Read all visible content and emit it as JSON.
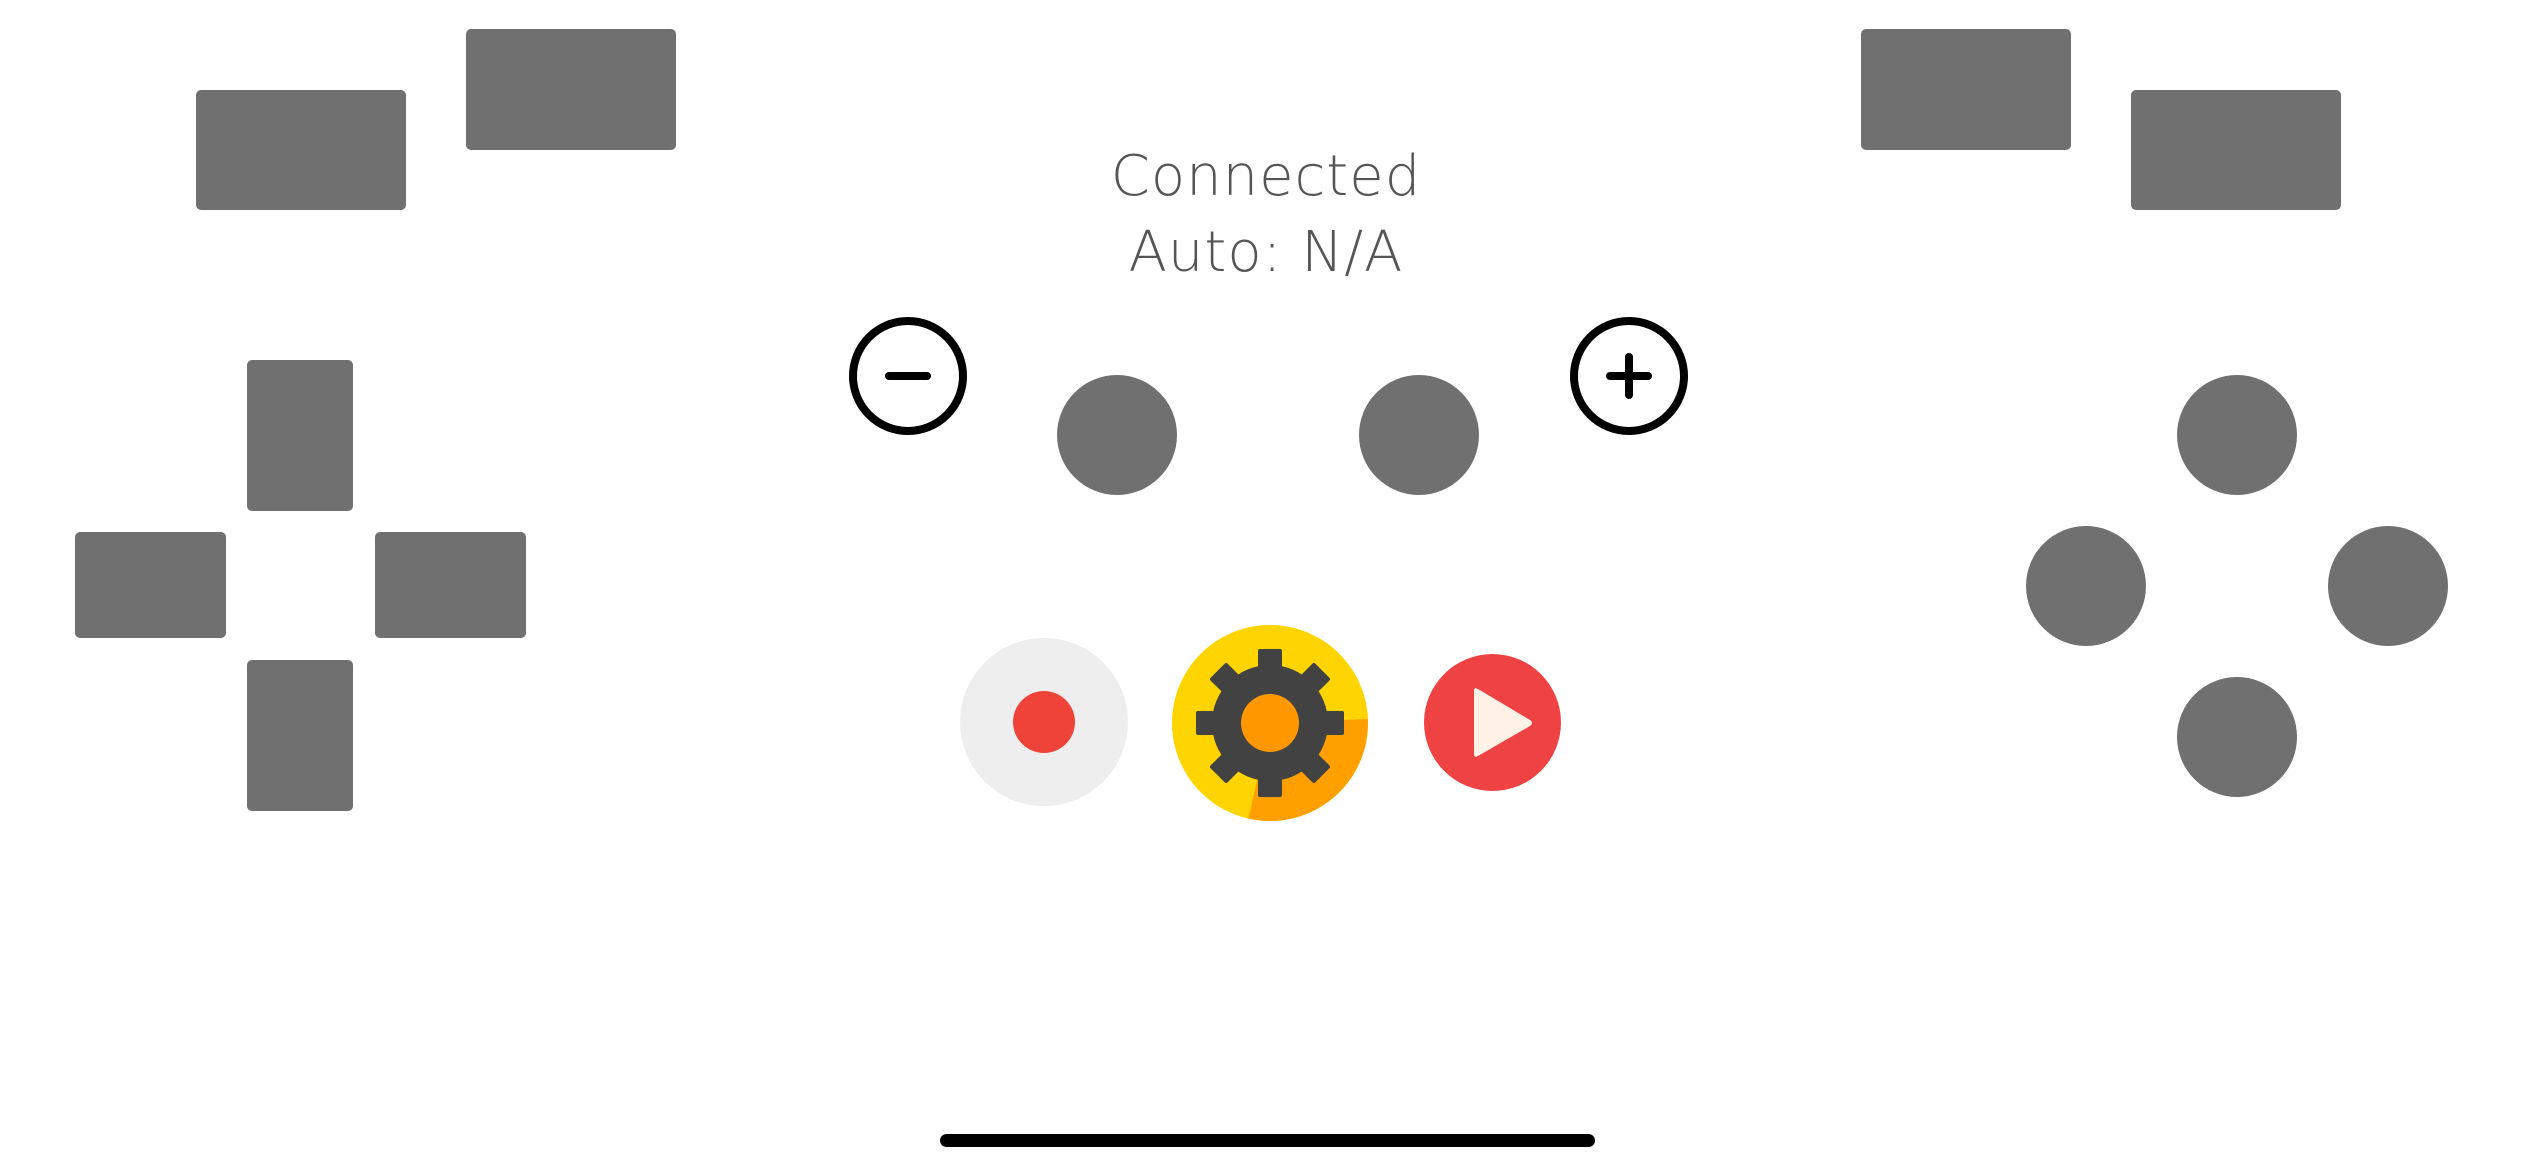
{
  "status": {
    "connection": "Connected",
    "auto": "Auto: N/A"
  },
  "colors": {
    "button": "#707070",
    "record_bg": "#eeeeee",
    "record_dot": "#ef4339",
    "settings_bg": "#ffd400",
    "settings_shadow": "#ffa000",
    "settings_gear": "#424242",
    "settings_center": "#ff9800",
    "play_bg": "#ef4343",
    "play_arrow": "#fff1e6"
  },
  "icons": {
    "minus": "minus-icon",
    "plus": "plus-icon",
    "record": "record-icon",
    "settings": "gear-icon",
    "play": "play-icon"
  }
}
